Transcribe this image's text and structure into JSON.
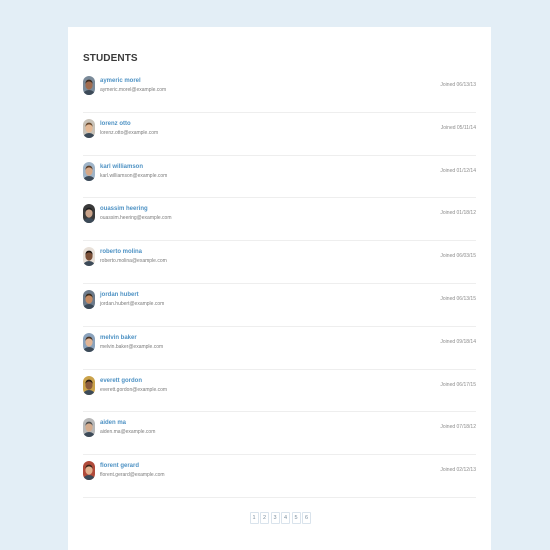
{
  "title": "STUDENTS",
  "students": [
    {
      "name": "aymeric morel",
      "email": "aymeric.morel@example.com",
      "joined": "Joined 06/13/13",
      "skin": "#a06b4e",
      "hair": "#3b2a20",
      "bg": "#7a8a99"
    },
    {
      "name": "lorenz otto",
      "email": "lorenz.otto@example.com",
      "joined": "Joined 05/11/14",
      "skin": "#e3b894",
      "hair": "#6a4a2e",
      "bg": "#c8c2b8"
    },
    {
      "name": "karl williamson",
      "email": "karl.williamson@example.com",
      "joined": "Joined 01/12/14",
      "skin": "#d6a887",
      "hair": "#5a3d28",
      "bg": "#9fb4c8"
    },
    {
      "name": "ouassim heering",
      "email": "ouassim.heering@example.com",
      "joined": "Joined 01/18/12",
      "skin": "#c9a38a",
      "hair": "#1f1f1f",
      "bg": "#3a3a3a"
    },
    {
      "name": "roberto molina",
      "email": "roberto.molina@example.com",
      "joined": "Joined 06/03/15",
      "skin": "#7a4f37",
      "hair": "#1e1410",
      "bg": "#e8e0d8"
    },
    {
      "name": "jordan hubert",
      "email": "jordan.hubert@example.com",
      "joined": "Joined 06/13/15",
      "skin": "#c48a62",
      "hair": "#3b2a1a",
      "bg": "#6c7a8a"
    },
    {
      "name": "melvin baker",
      "email": "melvin.baker@example.com",
      "joined": "Joined 09/18/14",
      "skin": "#e0b596",
      "hair": "#4a3322",
      "bg": "#8aa2bc"
    },
    {
      "name": "everett gordon",
      "email": "everett.gordon@example.com",
      "joined": "Joined 06/17/15",
      "skin": "#8a5a3c",
      "hair": "#2a1c12",
      "bg": "#caa24a"
    },
    {
      "name": "aiden ma",
      "email": "aiden.ma@example.com",
      "joined": "Joined 07/18/12",
      "skin": "#d4ab8c",
      "hair": "#4f4f4f",
      "bg": "#b8b8b8"
    },
    {
      "name": "florent gerard",
      "email": "florent.gerard@example.com",
      "joined": "Joined 02/12/13",
      "skin": "#e2b08e",
      "hair": "#3b2418",
      "bg": "#b04a3a"
    }
  ],
  "pagination": [
    "1",
    "2",
    "3",
    "4",
    "5",
    "6"
  ],
  "colors": {
    "background": "#e3eef6",
    "panel": "#ffffff",
    "name_link": "#4e92c4",
    "title": "#3a3a3a"
  }
}
